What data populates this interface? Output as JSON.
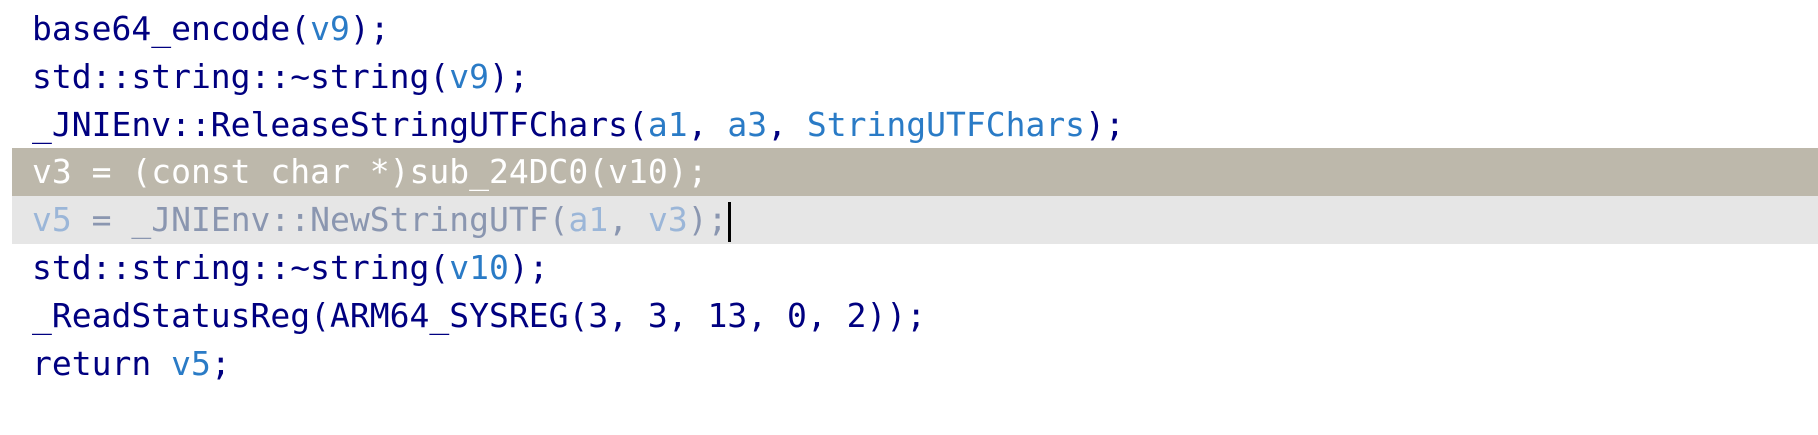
{
  "lines": [
    {
      "tokens": [
        {
          "t": "base64_encode",
          "k": "name"
        },
        {
          "t": "(",
          "k": "punc"
        },
        {
          "t": "v9",
          "k": "var"
        },
        {
          "t": ");",
          "k": "punc"
        }
      ]
    },
    {
      "tokens": [
        {
          "t": "std::string::~string",
          "k": "name"
        },
        {
          "t": "(",
          "k": "punc"
        },
        {
          "t": "v9",
          "k": "var"
        },
        {
          "t": ");",
          "k": "punc"
        }
      ]
    },
    {
      "tokens": [
        {
          "t": "_JNIEnv::ReleaseStringUTFChars",
          "k": "name"
        },
        {
          "t": "(",
          "k": "punc"
        },
        {
          "t": "a1",
          "k": "var"
        },
        {
          "t": ", ",
          "k": "punc"
        },
        {
          "t": "a3",
          "k": "var"
        },
        {
          "t": ", ",
          "k": "punc"
        },
        {
          "t": "StringUTFChars",
          "k": "var"
        },
        {
          "t": ");",
          "k": "punc"
        }
      ]
    },
    {
      "tokens": [
        {
          "t": "v3 = (const char *)sub_24DC0(v10);",
          "k": "name"
        }
      ]
    },
    {
      "tokens": [
        {
          "t": "v5",
          "k": "var"
        },
        {
          "t": " = _JNIEnv::NewStringUTF(",
          "k": "name"
        },
        {
          "t": "a1",
          "k": "var"
        },
        {
          "t": ", ",
          "k": "punc"
        },
        {
          "t": "v3",
          "k": "var"
        },
        {
          "t": ");",
          "k": "punc"
        }
      ]
    },
    {
      "tokens": [
        {
          "t": "std::string::~string",
          "k": "name"
        },
        {
          "t": "(",
          "k": "punc"
        },
        {
          "t": "v10",
          "k": "var"
        },
        {
          "t": ");",
          "k": "punc"
        }
      ]
    },
    {
      "tokens": [
        {
          "t": "_ReadStatusReg",
          "k": "name"
        },
        {
          "t": "(",
          "k": "punc"
        },
        {
          "t": "ARM64_SYSREG",
          "k": "name"
        },
        {
          "t": "(3, 3, 13, 0, 2));",
          "k": "num"
        }
      ]
    },
    {
      "tokens": [
        {
          "t": "return ",
          "k": "name"
        },
        {
          "t": "v5",
          "k": "var"
        },
        {
          "t": ";",
          "k": "punc"
        }
      ]
    }
  ]
}
